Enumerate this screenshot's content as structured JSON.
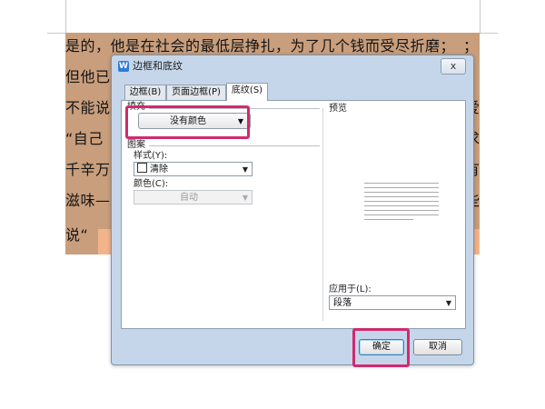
{
  "document": {
    "lines": [
      "是的，他是在社会的最低层挣扎，为了几个钱而受尽折磨；",
      "但他已",
      "不能说",
      "“自己",
      "千辛万",
      "滋味—",
      "说“"
    ],
    "right_fragments": [
      "；",
      "，",
      "爱",
      "求",
      "有",
      "些",
      ""
    ]
  },
  "dialog": {
    "title": "边框和底纹",
    "close_label": "x",
    "tabs": [
      {
        "label": "边框(B)",
        "active": false
      },
      {
        "label": "页面边框(P)",
        "active": false
      },
      {
        "label": "底纹(S)",
        "active": true
      }
    ],
    "fill": {
      "label": "填充",
      "value": "没有颜色"
    },
    "pattern": {
      "label": "图案",
      "style_label": "样式(Y):",
      "style_value": "清除",
      "color_label": "颜色(C):",
      "color_value": "自动"
    },
    "preview": {
      "label": "预览"
    },
    "apply_to": {
      "label": "应用于(L):",
      "value": "段落"
    },
    "ok_label": "确定",
    "cancel_label": "取消"
  },
  "colors": {
    "highlight": "#d12a6e",
    "document_shading": "#c99e7c",
    "dialog_frame": "#c6d6ea"
  }
}
